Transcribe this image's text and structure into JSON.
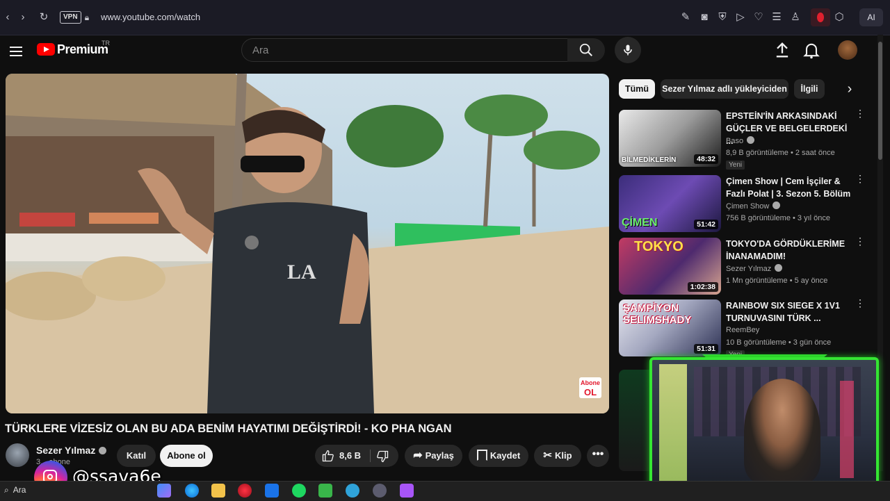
{
  "browser": {
    "vpn_label": "VPN",
    "url": "www.youtube.com/watch",
    "ai_label": "AI"
  },
  "header": {
    "logo_text": "Premium",
    "region": "TR",
    "search_placeholder": "Ara"
  },
  "video": {
    "title": "TÜRKLERE VİZESİZ OLAN BU ADA BENİM HAYATIMI DEĞİŞTİRDİ! - KO PHA NGAN",
    "overlay_line1": "Abone",
    "overlay_line2": "OL",
    "channel": "Sezer Yılmaz",
    "subscribers": "3... abone",
    "join_label": "Katıl",
    "subscribe_label": "Abone ol",
    "likes": "8,6 B",
    "share_label": "Paylaş",
    "save_label": "Kaydet",
    "clip_label": "Klip"
  },
  "chips": [
    "Tümü",
    "Sezer Yılmaz adlı yükleyiciden",
    "İlgili"
  ],
  "recommendations": [
    {
      "title": "EPSTEİN'İN ARKASINDAKİ GÜÇLER VE BELGELERDEKİ ...",
      "channel": "Baso",
      "meta": "8,9 B görüntüleme • 2 saat önce",
      "badge": "Yeni",
      "duration": "48:32",
      "thumb_text": "BİLMEDİKLERİN"
    },
    {
      "title": "Çimen Show | Cem İşçiler & Fazlı Polat | 3. Sezon 5. Bölüm",
      "channel": "Çimen Show",
      "meta": "756 B görüntüleme • 3 yıl önce",
      "duration": "51:42",
      "thumb_text": "ÇİMEN"
    },
    {
      "title": "TOKYO'DA GÖRDÜKLERİME İNANAMADIM!",
      "channel": "Sezer Yılmaz",
      "meta": "1 Mn görüntüleme • 5 ay önce",
      "duration": "1:02:38",
      "thumb_text": "TOKYO"
    },
    {
      "title": "RAINBOW SIX SIEGE X 1V1 TURNUVASINI TÜRK ...",
      "channel": "ReemBey",
      "meta": "10 B görüntüleme • 3 gün önce",
      "badge": "Yeni",
      "duration": "51:31",
      "thumb_text": "ŞAMPİYON SELIMSHADY"
    }
  ],
  "overlay": {
    "instagram_handle": "@ssava6e"
  },
  "taskbar": {
    "search_label": "Ara"
  },
  "colors": {
    "youtube_red": "#ff0000",
    "webcam_frame": "#35e633",
    "background": "#0f0f0f"
  }
}
